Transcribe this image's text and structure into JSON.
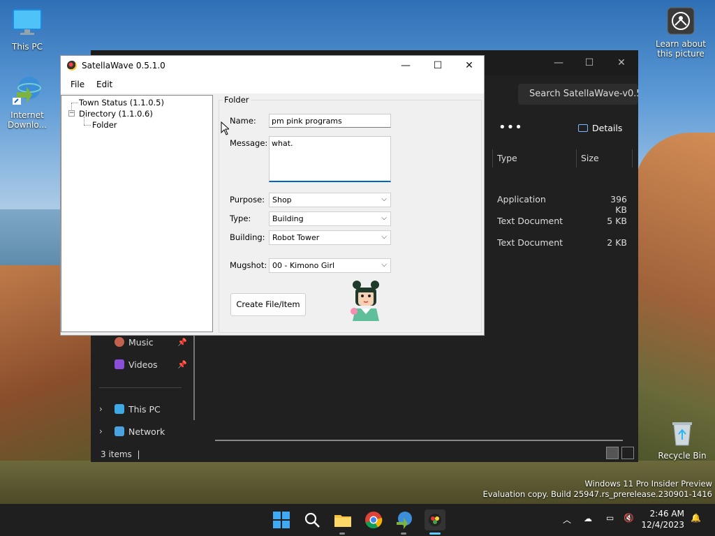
{
  "desktop": {
    "icons": [
      {
        "label": "This PC"
      },
      {
        "label": "Internet Downlo..."
      },
      {
        "label": "Learn about this picture"
      },
      {
        "label": "Recycle Bin"
      }
    ],
    "watermark_line1": "Windows 11 Pro Insider Preview",
    "watermark_line2": "Evaluation copy. Build 25947.rs_prerelease.230901-1416"
  },
  "explorer": {
    "search_placeholder": "Search SatellaWave-v0.5.",
    "more": "•••",
    "details_label": "Details",
    "columns": [
      "Type",
      "Size"
    ],
    "rows": [
      {
        "type": "Application",
        "size": "396 KB"
      },
      {
        "type": "Text Document",
        "size": "5 KB"
      },
      {
        "type": "Text Document",
        "size": "2 KB"
      }
    ],
    "nav": [
      {
        "label": "Music",
        "icon": "music-icon"
      },
      {
        "label": "Videos",
        "icon": "videos-icon"
      },
      {
        "label": "This PC",
        "icon": "this-pc-icon"
      },
      {
        "label": "Network",
        "icon": "network-icon"
      }
    ],
    "status": "3 items"
  },
  "satellawave": {
    "title": "SatellaWave 0.5.1.0",
    "menu": [
      "File",
      "Edit"
    ],
    "tree": [
      {
        "label": "Town Status (1.1.0.5)"
      },
      {
        "label": "Directory (1.1.0.6)"
      },
      {
        "label": "Folder"
      }
    ],
    "group_title": "Folder",
    "name_label": "Name:",
    "name_value": "pm pink programs",
    "message_label": "Message:",
    "message_value": "what.",
    "purpose_label": "Purpose:",
    "purpose_value": "Shop",
    "type_label": "Type:",
    "type_value": "Building",
    "building_label": "Building:",
    "building_value": "Robot Tower",
    "mugshot_label": "Mugshot:",
    "mugshot_value": "00 - Kimono Girl",
    "create_button": "Create File/Item"
  },
  "taskbar": {
    "time": "2:46 AM",
    "date": "12/4/2023"
  },
  "colors": {
    "accent": "#0067c0",
    "explorer_bg": "#202020",
    "taskbar_bg": "#1f1f1f"
  }
}
